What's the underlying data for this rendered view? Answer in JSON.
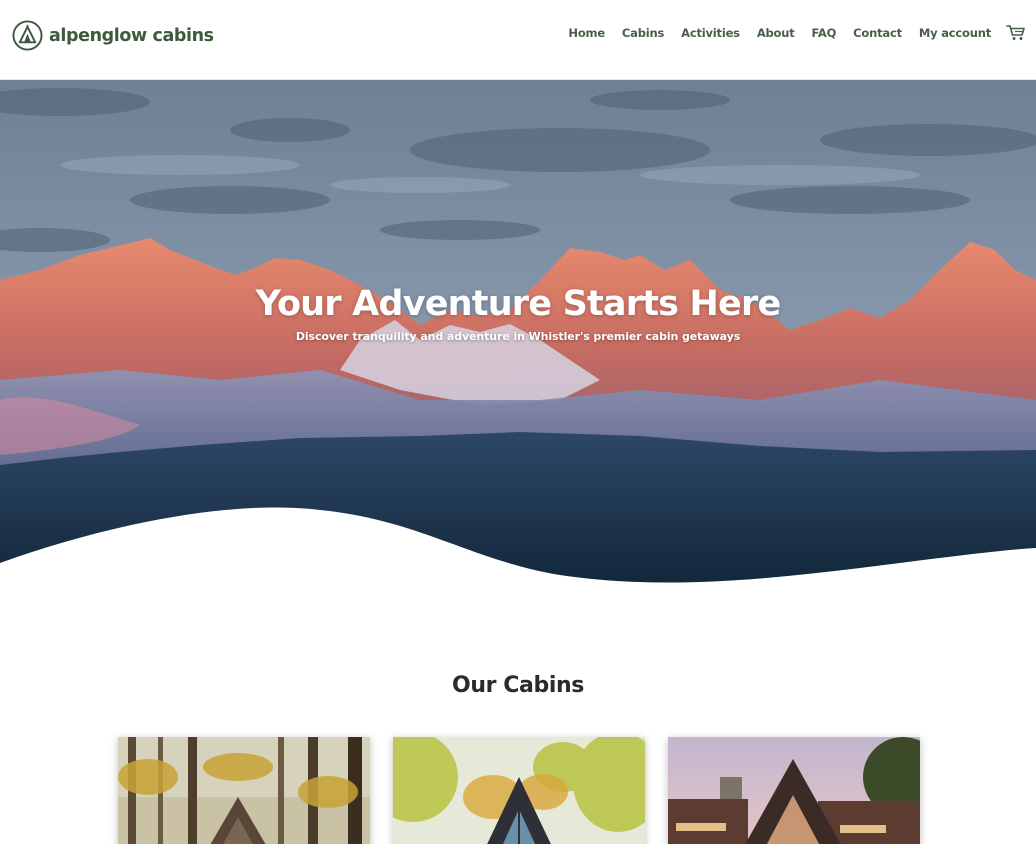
{
  "brand": {
    "name": "alpenglow cabins",
    "accent": "#3e5a3c"
  },
  "nav": {
    "items": [
      {
        "label": "Home"
      },
      {
        "label": "Cabins"
      },
      {
        "label": "Activities"
      },
      {
        "label": "About"
      },
      {
        "label": "FAQ"
      },
      {
        "label": "Contact"
      },
      {
        "label": "My account"
      }
    ],
    "cart_icon": "cart-icon"
  },
  "hero": {
    "title": "Your Adventure Starts Here",
    "subtitle": "Discover tranquility and adventure in Whistler's premier cabin getaways"
  },
  "cabins": {
    "title": "Our Cabins",
    "cards": [
      {
        "image": "forest-a-frame-cabin-photo"
      },
      {
        "image": "autumn-a-frame-cabin-photo"
      },
      {
        "image": "sunset-a-frame-cabin-photo"
      }
    ]
  }
}
